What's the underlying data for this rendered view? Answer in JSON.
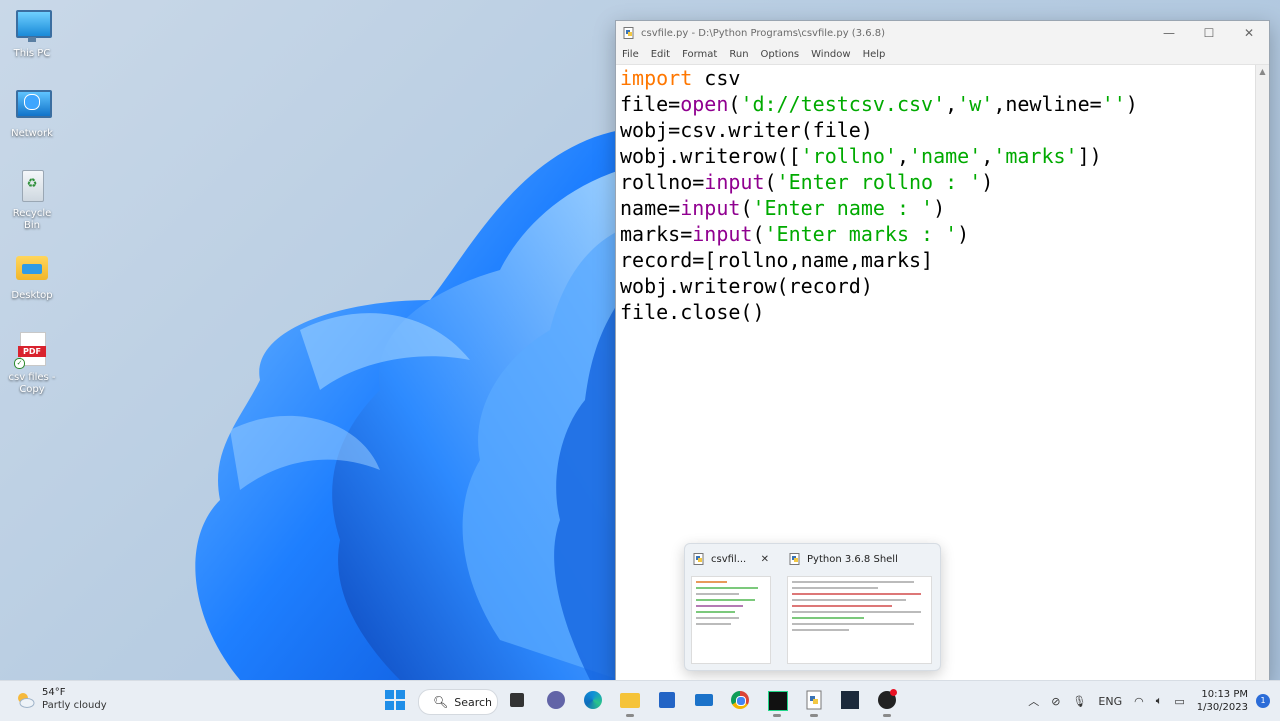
{
  "desktop": {
    "icons": [
      {
        "label": "This PC"
      },
      {
        "label": "Network"
      },
      {
        "label": "Recycle Bin"
      },
      {
        "label": "Desktop"
      },
      {
        "label": "csv files -\nCopy"
      }
    ],
    "pdf_badge": "PDF"
  },
  "window": {
    "title": "csvfile.py - D:\\Python Programs\\csvfile.py (3.6.8)",
    "menu": [
      "File",
      "Edit",
      "Format",
      "Run",
      "Options",
      "Window",
      "Help"
    ],
    "controls": {
      "minimize": "—",
      "maximize": "☐",
      "close": "✕"
    }
  },
  "code": [
    [
      {
        "t": "import",
        "c": "kw"
      },
      {
        "t": " csv",
        "c": ""
      }
    ],
    [
      {
        "t": "file=",
        "c": ""
      },
      {
        "t": "open",
        "c": "bi"
      },
      {
        "t": "(",
        "c": ""
      },
      {
        "t": "'d://testcsv.csv'",
        "c": "st"
      },
      {
        "t": ",",
        "c": ""
      },
      {
        "t": "'w'",
        "c": "st"
      },
      {
        "t": ",newline=",
        "c": ""
      },
      {
        "t": "''",
        "c": "st"
      },
      {
        "t": ")",
        "c": ""
      }
    ],
    [
      {
        "t": "wobj=csv.writer(file)",
        "c": ""
      }
    ],
    [
      {
        "t": "wobj.writerow([",
        "c": ""
      },
      {
        "t": "'rollno'",
        "c": "st"
      },
      {
        "t": ",",
        "c": ""
      },
      {
        "t": "'name'",
        "c": "st"
      },
      {
        "t": ",",
        "c": ""
      },
      {
        "t": "'marks'",
        "c": "st"
      },
      {
        "t": "])",
        "c": ""
      }
    ],
    [
      {
        "t": "rollno=",
        "c": ""
      },
      {
        "t": "input",
        "c": "bi"
      },
      {
        "t": "(",
        "c": ""
      },
      {
        "t": "'Enter rollno : '",
        "c": "st"
      },
      {
        "t": ")",
        "c": ""
      }
    ],
    [
      {
        "t": "name=",
        "c": ""
      },
      {
        "t": "input",
        "c": "bi"
      },
      {
        "t": "(",
        "c": ""
      },
      {
        "t": "'Enter name : '",
        "c": "st"
      },
      {
        "t": ")",
        "c": ""
      }
    ],
    [
      {
        "t": "marks=",
        "c": ""
      },
      {
        "t": "input",
        "c": "bi"
      },
      {
        "t": "(",
        "c": ""
      },
      {
        "t": "'Enter marks : '",
        "c": "st"
      },
      {
        "t": ")",
        "c": ""
      }
    ],
    [
      {
        "t": "record=[rollno,name,marks]",
        "c": ""
      }
    ],
    [
      {
        "t": "wobj.writerow(record)",
        "c": ""
      }
    ],
    [
      {
        "t": "file.close()",
        "c": ""
      }
    ]
  ],
  "thumbnails": [
    {
      "title": "csvfil...",
      "close": "✕"
    },
    {
      "title": "Python 3.6.8 Shell"
    }
  ],
  "taskbar": {
    "weather": {
      "temp": "54°F",
      "condition": "Partly cloudy"
    },
    "search_label": "Search",
    "tray": {
      "language": "ENG",
      "time": "10:13 PM",
      "date": "1/30/2023",
      "notifications": "1"
    }
  },
  "colors": {
    "keyword": "#ff7700",
    "builtin": "#900090",
    "string": "#00aa00",
    "accent": "#0078d4"
  }
}
